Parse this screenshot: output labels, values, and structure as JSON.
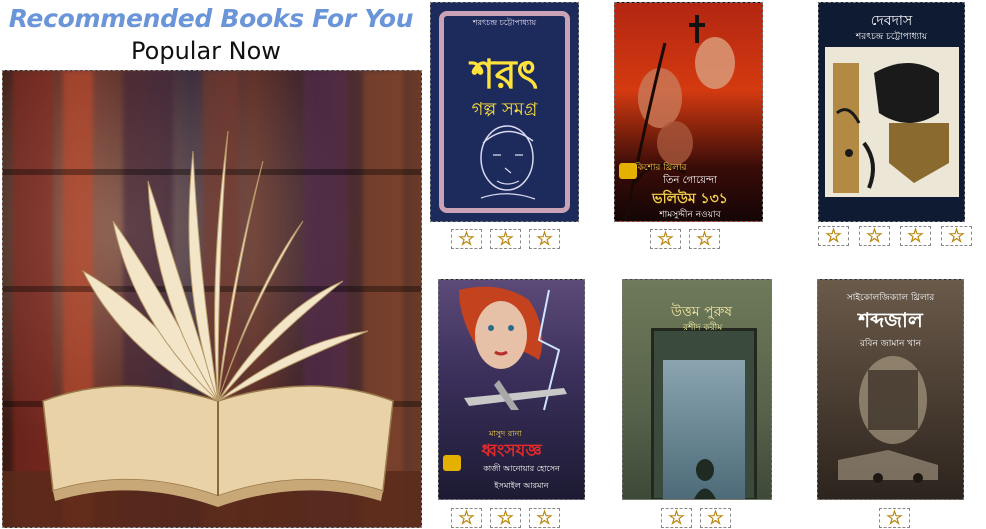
{
  "header": {
    "title": "Recommended Books For You",
    "subtitle": "Popular Now"
  },
  "hero": {
    "image_icon": "open-book-image"
  },
  "books": [
    {
      "title": "শরৎ",
      "subtitle": "গল্প সমগ্র",
      "author": "শরৎচন্দ্র চট্টোপাধ্যায়",
      "rating": 3
    },
    {
      "title": "ভলিউম ১৩১",
      "subtitle": "তিন গোয়েন্দা",
      "series": "কিশোর থ্রিলার",
      "author": "শামসুদ্দীন নওয়াব",
      "rating": 2
    },
    {
      "title": "দেবদাস",
      "author": "শরৎচন্দ্র চট্টোপাধ্যায়",
      "rating": 4
    },
    {
      "title": "ধ্বংসযজ্ঞ",
      "series": "মাসুদ রানা",
      "author": "কাজী আনোয়ার হোসেন",
      "coauthor": "ইসমাইল আরমান",
      "rating": 3
    },
    {
      "title": "উত্তম পুরুষ",
      "author": "রশীদ করীম",
      "rating": 2
    },
    {
      "title": "শব্দজাল",
      "series": "সাইকোলজিক্যাল থ্রিলার",
      "author": "রবিন জামান খান",
      "rating": 1
    }
  ],
  "star_glyph": "☆",
  "colors": {
    "heading": "#6a95d8",
    "star": "#f5c518"
  }
}
